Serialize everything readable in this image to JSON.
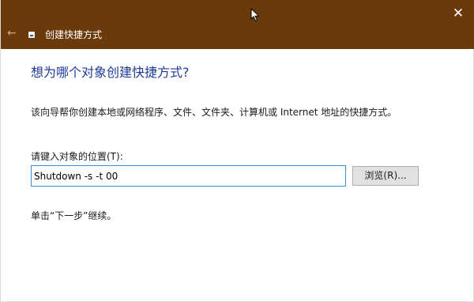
{
  "window": {
    "title": "创建快捷方式",
    "close_glyph": "✕",
    "back_glyph": "←",
    "titlebar_color": "#6b3a0b"
  },
  "page": {
    "heading": "想为哪个对象创建快捷方式?",
    "description": "该向导帮你创建本地或网络程序、文件、文件夹、计算机或 Internet 地址的快捷方式。",
    "location_label": "请键入对象的位置(T):",
    "location_value": "Shutdown -s -t 00",
    "browse_label": "浏览(R)...",
    "hint": "单击“下一步”继续。"
  },
  "icons": {
    "back": "back-arrow-icon",
    "close": "close-icon",
    "app": "shortcut-wizard-icon",
    "cursor": "mouse-cursor-icon"
  },
  "colors": {
    "heading": "#1f3c99",
    "input_border": "#3c8fd6"
  }
}
